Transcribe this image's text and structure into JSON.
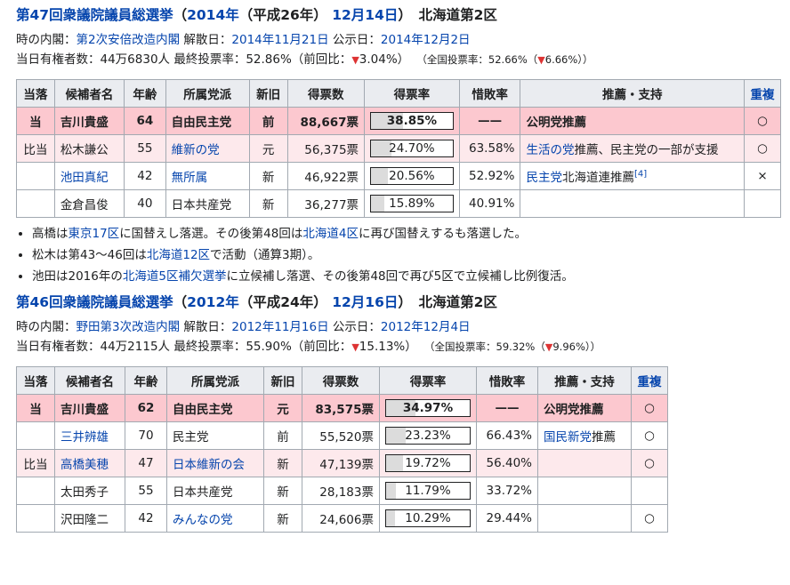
{
  "e47": {
    "title": {
      "election": "第47回衆議院議員総選挙",
      "open": "（",
      "year": "2014年",
      "era": "（平成26年）",
      "date": "12月14日",
      "close": "）",
      "district": "北海道第2区"
    },
    "info": {
      "cabinet_label": "時の内閣：",
      "cabinet": "第2次安倍改造内閣",
      "dissolution_label": " 解散日：",
      "dissolution": "2014年11月21日",
      "announce_label": " 公示日：",
      "announce": "2014年12月2日",
      "turnout_pre": "当日有権者数：44万6830人 最終投票率：52.86%（前回比：",
      "turnout_change": "▼",
      "turnout_post": "3.04%）",
      "national_pre": "（全国投票率：52.66%（",
      "national_change": "▼",
      "national_post": "6.66%））"
    },
    "headers": [
      "当落",
      "候補者名",
      "年齢",
      "所属党派",
      "新旧",
      "得票数",
      "得票率",
      "惜敗率",
      "推薦・支持",
      "重複"
    ],
    "rows": [
      {
        "result": "当",
        "name": "吉川貴盛",
        "age": "64",
        "party": "自由民主党",
        "status": "前",
        "votes": "88,667票",
        "rate": "38.85%",
        "ratio": "——",
        "support": "公明党推薦",
        "dup": "○"
      },
      {
        "result": "比当",
        "name": "松木謙公",
        "age": "55",
        "party": "維新の党",
        "status": "元",
        "votes": "56,375票",
        "rate": "24.70%",
        "ratio": "63.58%",
        "support_a": "生活の党",
        "support_b": "推薦、民主党の一部が支援",
        "dup": "○"
      },
      {
        "result": "",
        "name": "池田真紀",
        "age": "42",
        "party": "無所属",
        "status": "新",
        "votes": "46,922票",
        "rate": "20.56%",
        "ratio": "52.92%",
        "support_a": "民主党",
        "support_b": "北海道連推薦",
        "support_ref": "[4]",
        "dup": "×"
      },
      {
        "result": "",
        "name": "金倉昌俊",
        "age": "40",
        "party": "日本共産党",
        "status": "新",
        "votes": "36,277票",
        "rate": "15.89%",
        "ratio": "40.91%",
        "support": "",
        "dup": ""
      }
    ],
    "notes": [
      {
        "a": "高橋は",
        "b": "東京17区",
        "c": "に国替えし落選。その後第48回は",
        "d": "北海道4区",
        "e": "に再び国替えするも落選した。"
      },
      {
        "a": "松木は第43〜46回は",
        "b": "北海道12区",
        "c": "で活動（通算3期）。"
      },
      {
        "a": "池田は2016年の",
        "b": "北海道5区補欠選挙",
        "c": "に立候補し落選、その後第48回で再び5区で立候補し比例復活。"
      }
    ]
  },
  "e46": {
    "title": {
      "election": "第46回衆議院議員総選挙",
      "open": "（",
      "year": "2012年",
      "era": "（平成24年）",
      "date": "12月16日",
      "close": "）",
      "district": "北海道第2区"
    },
    "info": {
      "cabinet_label": "時の内閣：",
      "cabinet": "野田第3次改造内閣",
      "dissolution_label": " 解散日：",
      "dissolution": "2012年11月16日",
      "announce_label": " 公示日：",
      "announce": "2012年12月4日",
      "turnout_pre": "当日有権者数：44万2115人 最終投票率：55.90%（前回比：",
      "turnout_change": "▼",
      "turnout_post": "15.13%）",
      "national_pre": "（全国投票率：59.32%（",
      "national_change": "▼",
      "national_post": "9.96%））"
    },
    "headers": [
      "当落",
      "候補者名",
      "年齢",
      "所属党派",
      "新旧",
      "得票数",
      "得票率",
      "惜敗率",
      "推薦・支持",
      "重複"
    ],
    "rows": [
      {
        "result": "当",
        "name": "吉川貴盛",
        "age": "62",
        "party": "自由民主党",
        "status": "元",
        "votes": "83,575票",
        "rate": "34.97%",
        "ratio": "——",
        "support": "公明党推薦",
        "dup": "○"
      },
      {
        "result": "",
        "name": "三井辨雄",
        "age": "70",
        "party": "民主党",
        "status": "前",
        "votes": "55,520票",
        "rate": "23.23%",
        "ratio": "66.43%",
        "support_a": "国民新党",
        "support_b": "推薦",
        "dup": "○"
      },
      {
        "result": "比当",
        "name": "高橋美穂",
        "age": "47",
        "party": "日本維新の会",
        "status": "新",
        "votes": "47,139票",
        "rate": "19.72%",
        "ratio": "56.40%",
        "support": "",
        "dup": "○"
      },
      {
        "result": "",
        "name": "太田秀子",
        "age": "55",
        "party": "日本共産党",
        "status": "新",
        "votes": "28,183票",
        "rate": "11.79%",
        "ratio": "33.72%",
        "support": "",
        "dup": ""
      },
      {
        "result": "",
        "name": "沢田隆二",
        "age": "42",
        "party": "みんなの党",
        "status": "新",
        "votes": "24,606票",
        "rate": "10.29%",
        "ratio": "29.44%",
        "support": "",
        "dup": "○"
      }
    ]
  }
}
